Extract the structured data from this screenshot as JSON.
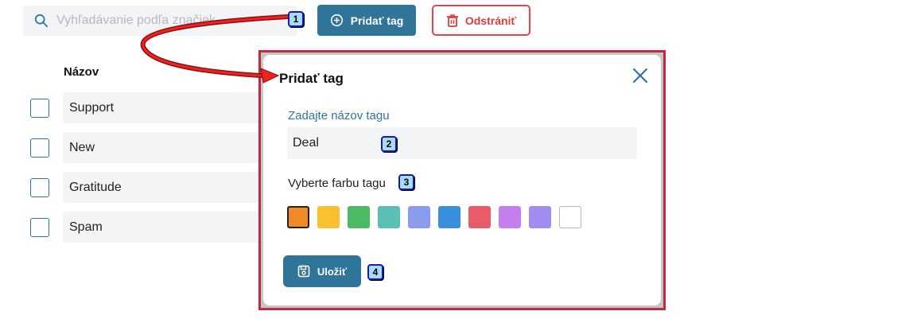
{
  "toolbar": {
    "search_placeholder": "Vyhľadávanie podľa značiek",
    "add_label": "Pridať tag",
    "delete_label": "Odstrániť"
  },
  "table": {
    "column_header": "Názov",
    "rows": [
      {
        "name": "Support"
      },
      {
        "name": "New"
      },
      {
        "name": "Gratitude"
      },
      {
        "name": "Spam"
      }
    ]
  },
  "modal": {
    "title": "Pridať tag",
    "name_label": "Zadajte názov tagu",
    "name_value": "Deal",
    "color_label": "Vyberte farbu tagu",
    "colors": [
      "#f08a24",
      "#fbc02d",
      "#4cb963",
      "#5bbfb5",
      "#8a9cf0",
      "#3a8fdd",
      "#e85c6a",
      "#c47ef0",
      "#a18cf0",
      "#ffffff"
    ],
    "selected_color_index": 0,
    "save_label": "Uložiť"
  },
  "annotations": {
    "step1": "1",
    "step2": "2",
    "step3": "3",
    "step4": "4"
  },
  "theme": {
    "primary": "#2e7599",
    "danger": "#e24747",
    "highlight_border": "#c42a3b"
  }
}
